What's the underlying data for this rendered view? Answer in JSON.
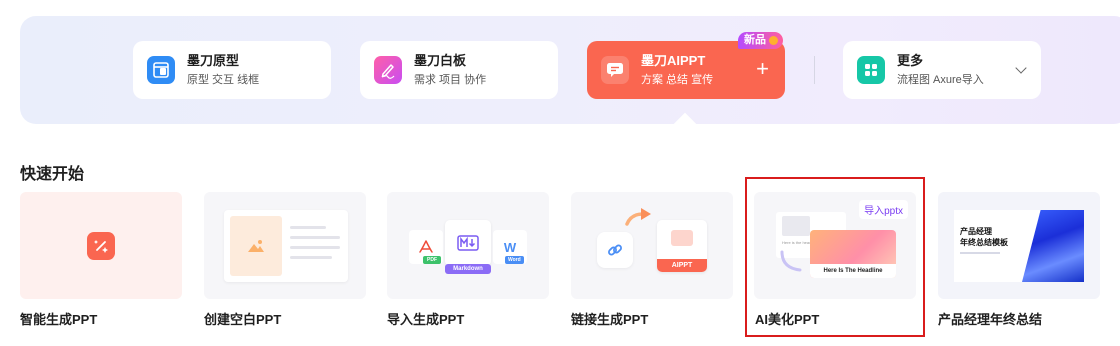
{
  "tools": [
    {
      "title": "墨刀原型",
      "subtitle": "原型 交互 线框",
      "icon": "prototype-icon",
      "color": "#2f8cf5"
    },
    {
      "title": "墨刀白板",
      "subtitle": "需求 项目 协作",
      "icon": "whiteboard-pen-icon",
      "color": "#e24bd9"
    },
    {
      "title": "墨刀AIPPT",
      "subtitle": "方案 总结 宣传",
      "icon": "ai-ppt-icon",
      "color": "#fa6650",
      "badge": "新品"
    },
    {
      "title": "更多",
      "subtitle": "流程图 Axure导入",
      "icon": "grid-apps-icon",
      "color": "#16c7a7"
    }
  ],
  "quick_start": {
    "title": "快速开始",
    "cards": [
      {
        "label": "智能生成PPT"
      },
      {
        "label": "创建空白PPT"
      },
      {
        "label": "导入生成PPT",
        "file_types": [
          "PDF",
          "Markdown",
          "Word"
        ]
      },
      {
        "label": "链接生成PPT",
        "tag": "AIPPT"
      },
      {
        "label": "AI美化PPT",
        "import_tag": "导入pptx",
        "headline": "Here Is The Headline",
        "small_text": "Here is the headline"
      },
      {
        "label": "产品经理年终总结",
        "template_title_line1": "产品经理",
        "template_title_line2": "年终总结模板"
      }
    ]
  },
  "colors": {
    "accent": "#fa6650",
    "highlight_border": "#d91c1c"
  }
}
